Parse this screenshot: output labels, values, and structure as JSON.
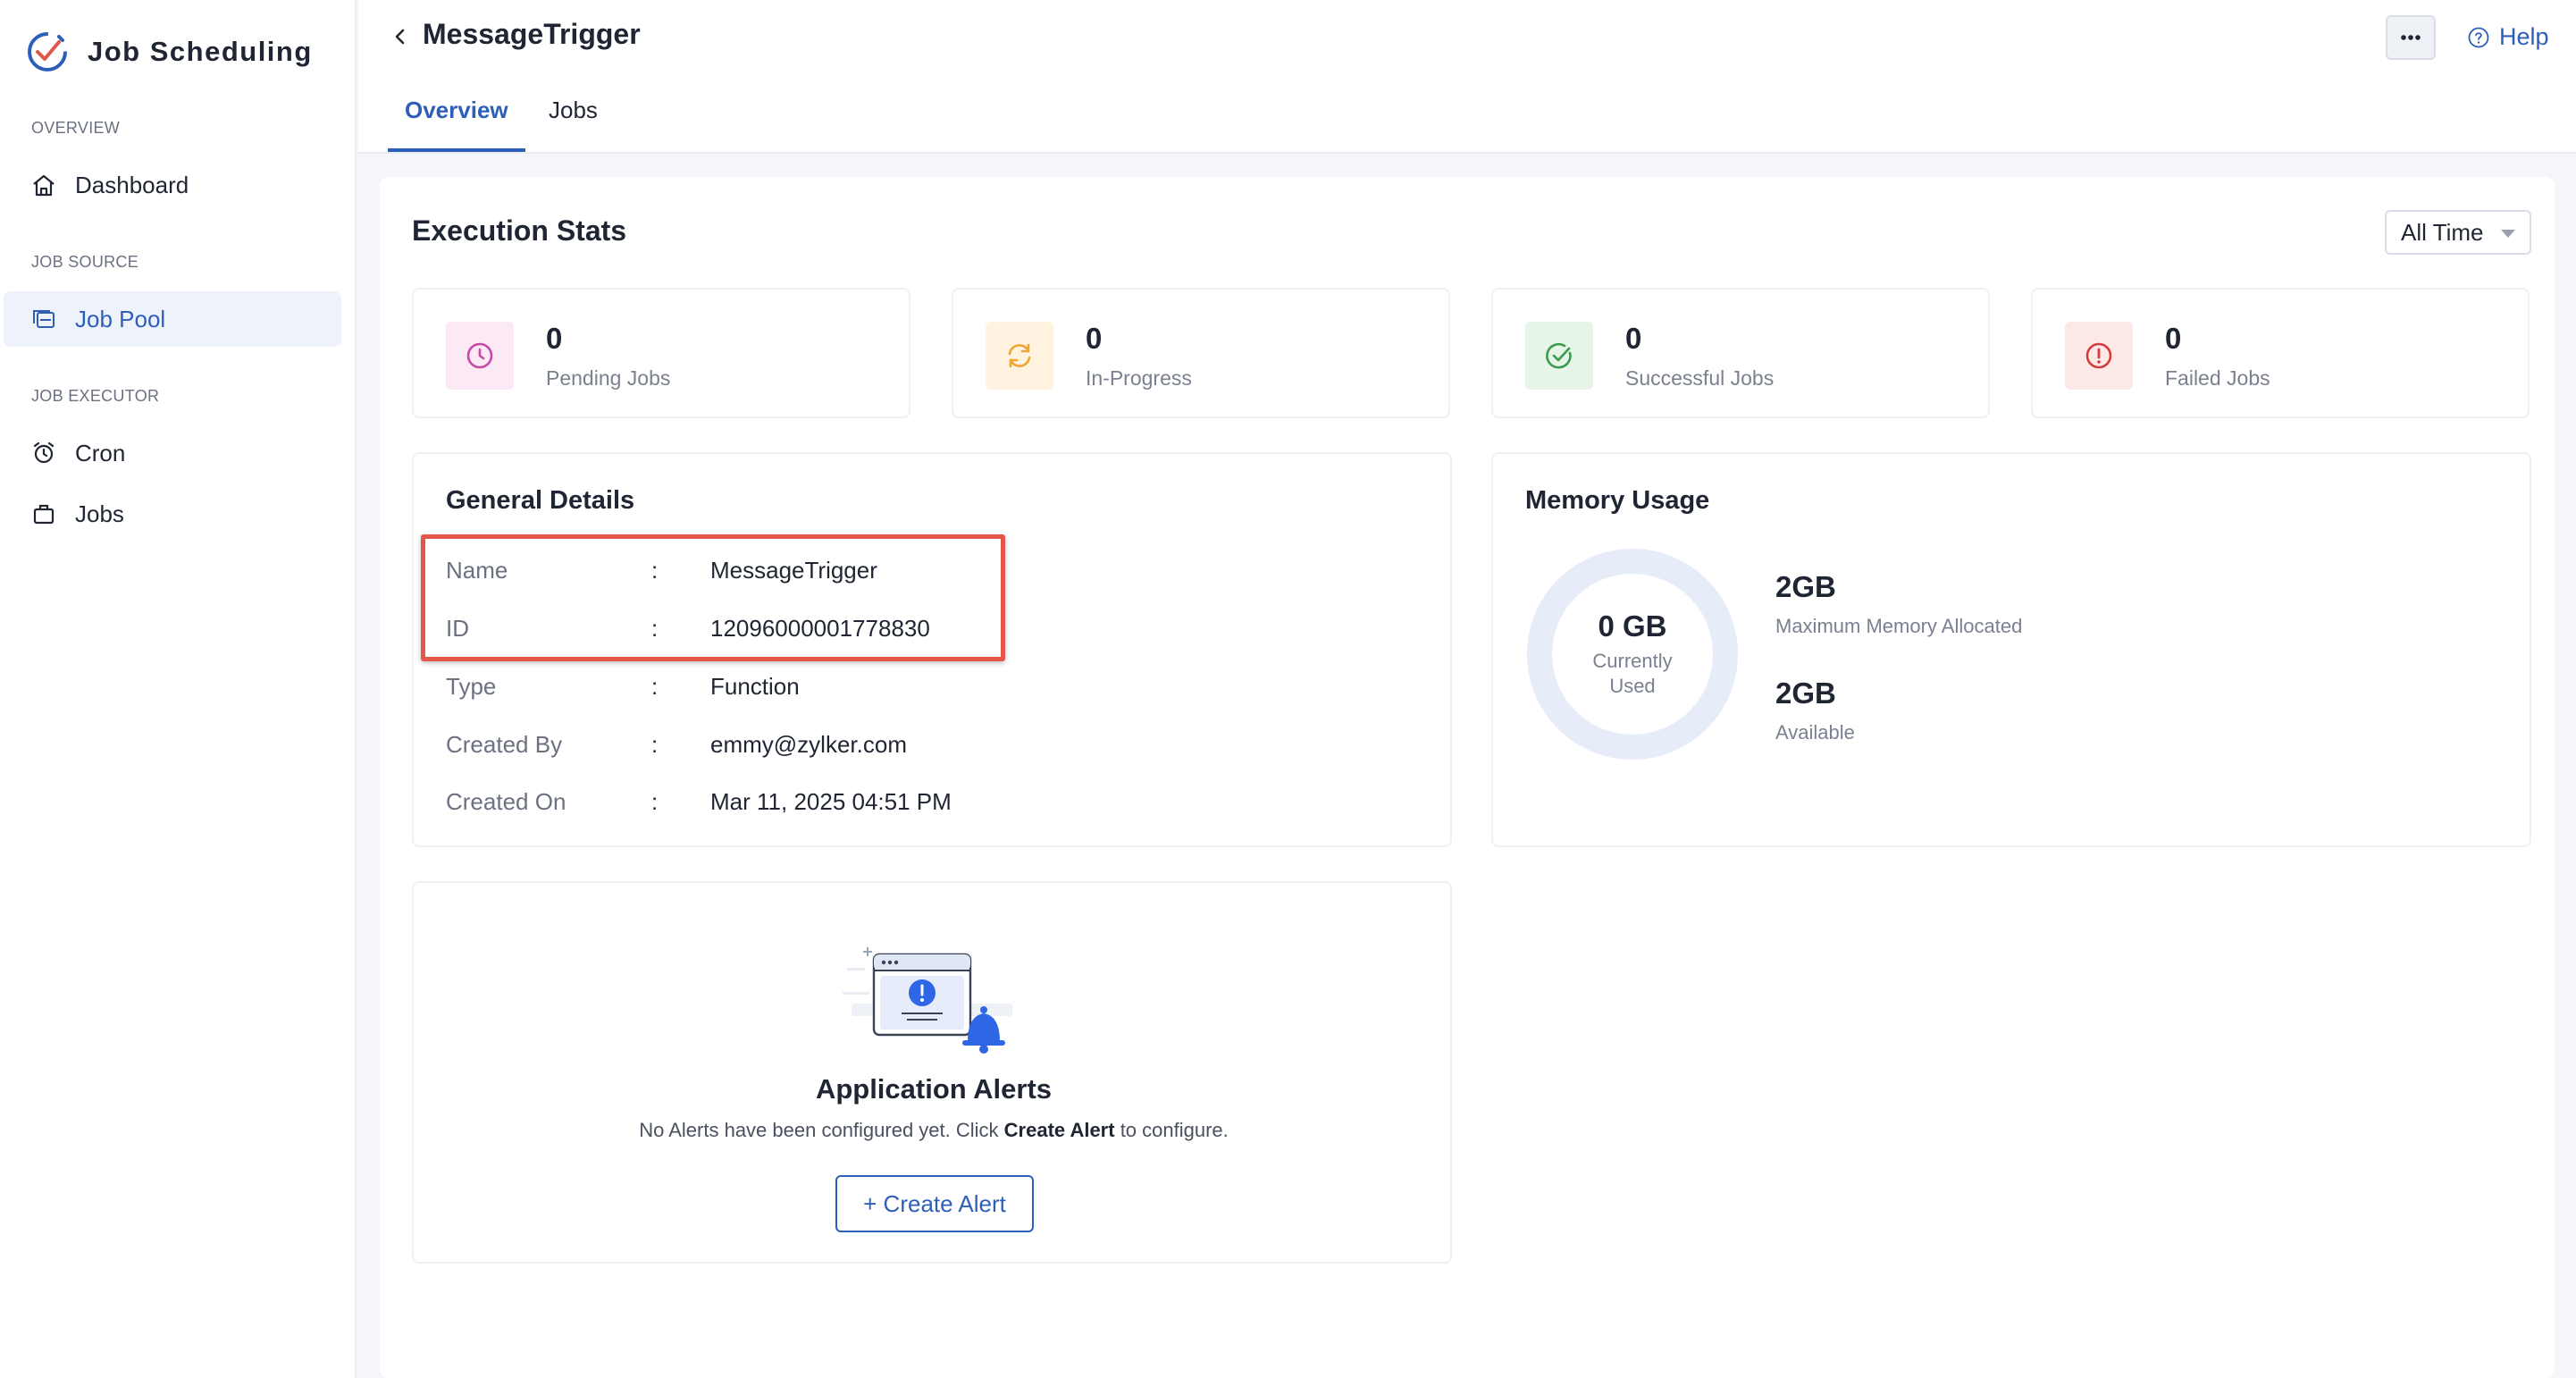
{
  "app": {
    "title": "Job Scheduling"
  },
  "sidebar": {
    "sections": [
      {
        "label": "OVERVIEW",
        "items": [
          {
            "label": "Dashboard",
            "icon": "home-icon"
          }
        ]
      },
      {
        "label": "JOB SOURCE",
        "items": [
          {
            "label": "Job Pool",
            "icon": "job-pool-icon",
            "active": true
          }
        ]
      },
      {
        "label": "JOB EXECUTOR",
        "items": [
          {
            "label": "Cron",
            "icon": "alarm-clock-icon"
          },
          {
            "label": "Jobs",
            "icon": "briefcase-icon"
          }
        ]
      }
    ]
  },
  "header": {
    "title": "MessageTrigger",
    "tabs": [
      {
        "label": "Overview",
        "active": true
      },
      {
        "label": "Jobs"
      }
    ],
    "help_label": "Help"
  },
  "execution_stats": {
    "title": "Execution Stats",
    "time_filter": "All Time",
    "cards": [
      {
        "value": "0",
        "label": "Pending Jobs",
        "icon": "clock-icon",
        "color": "#c74aa6",
        "bg": "#fbe9f5"
      },
      {
        "value": "0",
        "label": "In-Progress",
        "icon": "refresh-icon",
        "color": "#f0a431",
        "bg": "#fff3df"
      },
      {
        "value": "0",
        "label": "Successful Jobs",
        "icon": "check-circle-icon",
        "color": "#3a9a4e",
        "bg": "#e6f5e8"
      },
      {
        "value": "0",
        "label": "Failed Jobs",
        "icon": "error-circle-icon",
        "color": "#d63b3b",
        "bg": "#fde8e8"
      }
    ]
  },
  "general_details": {
    "title": "General Details",
    "rows": [
      {
        "key": "Name",
        "value": "MessageTrigger"
      },
      {
        "key": "ID",
        "value": "12096000001778830"
      },
      {
        "key": "Type",
        "value": "Function"
      },
      {
        "key": "Created By",
        "value": "emmy@zylker.com"
      },
      {
        "key": "Created On",
        "value": "Mar 11, 2025 04:51 PM"
      }
    ],
    "separator": ":"
  },
  "memory_usage": {
    "title": "Memory Usage",
    "currently_used": "0 GB",
    "currently_used_label": "Currently Used",
    "max_allocated": "2GB",
    "max_allocated_label": "Maximum Memory Allocated",
    "available": "2GB",
    "available_label": "Available"
  },
  "alerts": {
    "title": "Application Alerts",
    "desc_before": "No Alerts have been configured yet. Click ",
    "desc_bold": "Create Alert",
    "desc_after": " to configure.",
    "button_label": "+ Create Alert"
  },
  "colors": {
    "accent": "#2e5fb8",
    "highlight": "#e2574a"
  }
}
